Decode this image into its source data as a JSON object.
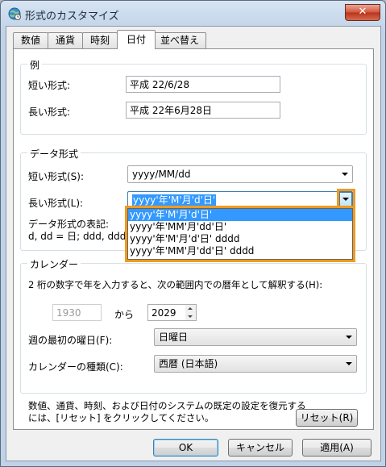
{
  "window": {
    "title": "形式のカスタマイズ",
    "close_label": "✕"
  },
  "tabs": [
    {
      "label": "数値"
    },
    {
      "label": "通貨"
    },
    {
      "label": "時刻"
    },
    {
      "label": "日付"
    },
    {
      "label": "並べ替え"
    }
  ],
  "example": {
    "group_title": "例",
    "short_label": "短い形式:",
    "short_value": "平成 22/6/28",
    "long_label": "長い形式:",
    "long_value": "平成 22年6月28日"
  },
  "data_format": {
    "group_title": "データ形式",
    "short_label": "短い形式(S):",
    "short_value": "yyyy/MM/dd",
    "long_label": "長い形式(L):",
    "long_value": "yyyy'年'M'月'd'日'",
    "notation_label": "データ形式の表記:",
    "notation_text": "d, dd = 日;  ddd, ddd",
    "dropdown_options": [
      "yyyy'年'M'月'd'日'",
      "yyyy'年'MM'月'dd'日'",
      "yyyy'年'M'月'd'日' dddd",
      "yyyy'年'MM'月'dd'日' dddd"
    ]
  },
  "calendar": {
    "group_title": "カレンダー",
    "description": "2 桁の数字で年を入力すると、次の範囲内での暦年として解釈する(H):",
    "from_year": "1930",
    "from_label": "から",
    "to_year": "2029",
    "first_day_label": "週の最初の曜日(F):",
    "first_day_value": "日曜日",
    "type_label": "カレンダーの種類(C):",
    "type_value": "西暦 (日本語)"
  },
  "reset": {
    "text_line1": "数値、通貨、時刻、および日付のシステムの既定の設定を復元する",
    "text_line2": "には、[リセット] をクリックしてください。",
    "button_label": "リセット(R)"
  },
  "buttons": {
    "ok": "OK",
    "cancel": "キャンセル",
    "apply": "適用(A)"
  },
  "colors": {
    "highlight": "#f39a1e",
    "selection": "#3399ff"
  }
}
